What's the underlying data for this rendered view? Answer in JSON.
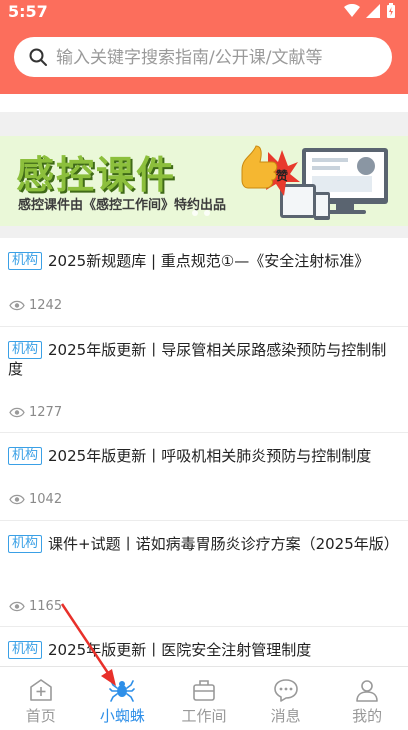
{
  "status_bar": {
    "time": "5:57"
  },
  "search": {
    "placeholder": "输入关键字搜索指南/公开课/文献等"
  },
  "banner": {
    "title": "感控课件",
    "subtitle": "感控课件由《感控工作间》特约出品",
    "badge": "赞"
  },
  "articles": [
    {
      "tag": "机构",
      "title": "2025新规题库 | 重点规范①—《安全注射标准》",
      "views": "1242"
    },
    {
      "tag": "机构",
      "title": "2025年版更新丨导尿管相关尿路感染预防与控制制度",
      "views": "1277"
    },
    {
      "tag": "机构",
      "title": "2025年版更新丨呼吸机相关肺炎预防与控制制度",
      "views": "1042"
    },
    {
      "tag": "机构",
      "title": "课件+试题丨诺如病毒胃肠炎诊疗方案（2025年版）",
      "views": "1165"
    },
    {
      "tag": "机构",
      "title": "2025年版更新丨医院安全注射管理制度",
      "views": ""
    }
  ],
  "tabbar": [
    {
      "label": "首页",
      "icon": "home-plus-icon",
      "active": false
    },
    {
      "label": "小蜘蛛",
      "icon": "spider-icon",
      "active": true
    },
    {
      "label": "工作间",
      "icon": "briefcase-icon",
      "active": false
    },
    {
      "label": "消息",
      "icon": "chat-bubble-icon",
      "active": false
    },
    {
      "label": "我的",
      "icon": "user-icon",
      "active": false
    }
  ],
  "colors": {
    "header": "#fc6e5c",
    "accent": "#2e8fe8",
    "tag": "#3aa0e6",
    "banner_green": "#8cbf3c"
  }
}
